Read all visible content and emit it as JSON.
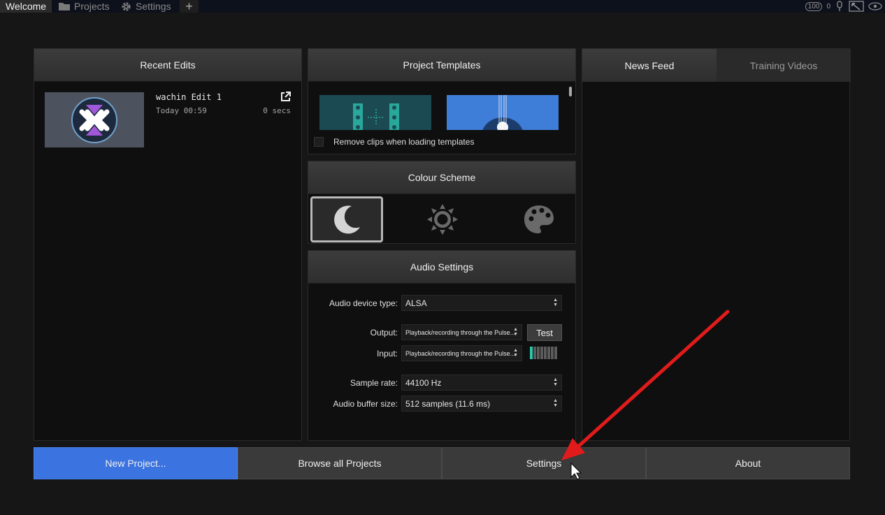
{
  "tabs": [
    {
      "label": "Welcome",
      "icon": "none"
    },
    {
      "label": "Projects",
      "icon": "folder-icon"
    },
    {
      "label": "Settings",
      "icon": "gear-icon"
    }
  ],
  "status": {
    "cpu": "100",
    "count": "0"
  },
  "recent_edits": {
    "title": "Recent Edits",
    "items": [
      {
        "name": "wachin Edit 1",
        "time": "Today 00:59",
        "duration": "0 secs"
      }
    ]
  },
  "templates": {
    "title": "Project Templates",
    "checkbox_label": "Remove clips when loading templates",
    "checked": false
  },
  "colour_scheme": {
    "title": "Colour Scheme",
    "options": [
      "dark-moon-icon",
      "light-sun-icon",
      "custom-palette-icon"
    ],
    "selected": 0
  },
  "audio": {
    "title": "Audio Settings",
    "device_type_label": "Audio device type:",
    "device_type": "ALSA",
    "output_label": "Output:",
    "output": "Playback/recording through the Pulse...",
    "test_label": "Test",
    "input_label": "Input:",
    "input": "Playback/recording through the Pulse...",
    "sample_rate_label": "Sample rate:",
    "sample_rate": "44100 Hz",
    "buffer_label": "Audio buffer size:",
    "buffer": "512 samples (11.6 ms)",
    "input_level_segments_lit": 1,
    "input_level_segments_total": 8
  },
  "news": {
    "tabs": [
      "News Feed",
      "Training Videos"
    ],
    "active": 0
  },
  "bottom": {
    "new_project": "New Project...",
    "browse": "Browse all Projects",
    "settings": "Settings",
    "about": "About"
  },
  "colors": {
    "accent": "#3b73e0",
    "meter": "#2ec6a8",
    "arrow": "#e11b1b"
  }
}
